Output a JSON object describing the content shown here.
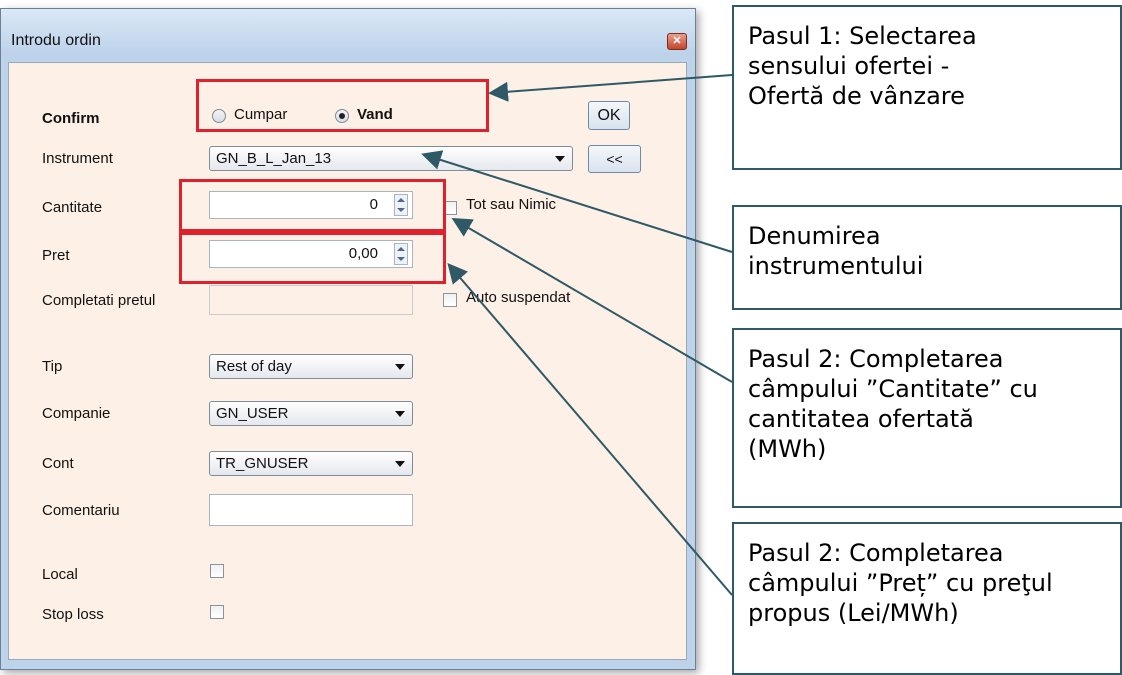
{
  "window": {
    "title": "Introdu ordin"
  },
  "form": {
    "confirm_label": "Confirm",
    "side": {
      "buy_label": "Cumpar",
      "sell_label": "Vand",
      "selected": "sell"
    },
    "ok_label": "OK",
    "instrument": {
      "label": "Instrument",
      "value": "GN_B_L_Jan_13",
      "back_label": "<<"
    },
    "quantity": {
      "label": "Cantitate",
      "value": "0"
    },
    "all_or_none_label": "Tot sau Nimic",
    "price": {
      "label": "Pret",
      "value": "0,00"
    },
    "fill_price": {
      "label": "Completati pretul",
      "value": ""
    },
    "auto_suspend_label": "Auto suspendat",
    "type": {
      "label": "Tip",
      "value": "Rest of day"
    },
    "company": {
      "label": "Companie",
      "value": "GN_USER"
    },
    "account": {
      "label": "Cont",
      "value": "TR_GNUSER"
    },
    "comment": {
      "label": "Comentariu",
      "value": ""
    },
    "local_label": "Local",
    "stop_loss_label": "Stop loss"
  },
  "callouts": {
    "step1": "Pasul 1: Selectarea\nsensului ofertei -\nOfertă de vânzare",
    "instrument_name": "Denumirea\ninstrumentului",
    "step2_quantity": "Pasul 2: Completarea\ncâmpului ”Cantitate” cu\ncantitatea ofertată\n(MWh)",
    "step2_price": "Pasul 2: Completarea\ncâmpului ”Preț” cu preţul\npropus (Lei/MWh)"
  },
  "colors": {
    "highlight": "#e0202a",
    "callout_border": "#2f5966",
    "dialog_bg": "#fdf0e6"
  }
}
